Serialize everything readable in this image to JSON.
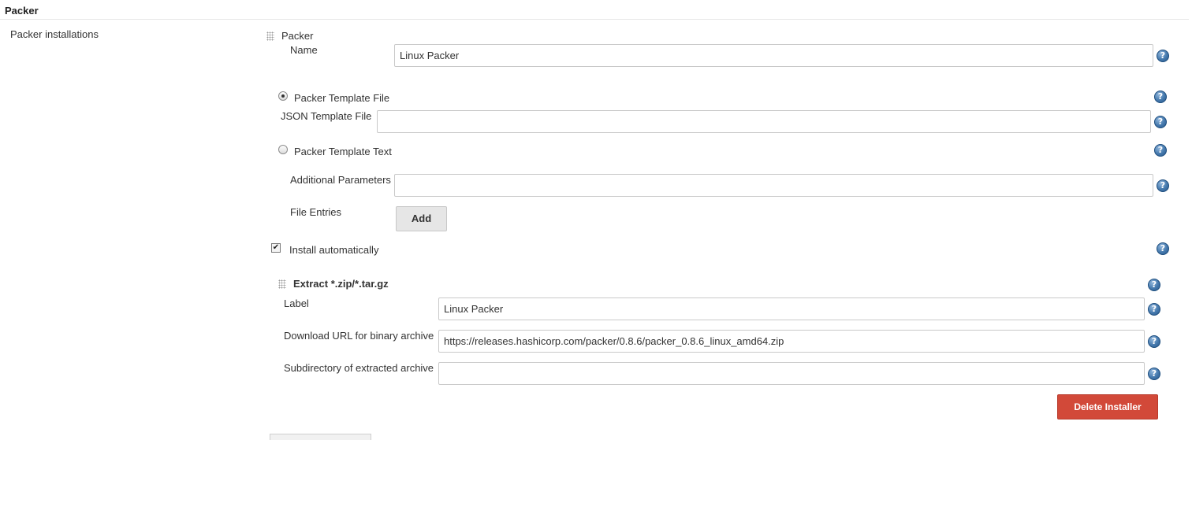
{
  "section": {
    "title": "Packer"
  },
  "installations_label": "Packer installations",
  "installation": {
    "header": "Packer",
    "name": {
      "label": "Name",
      "value": "Linux Packer",
      "help_icon": "question-circle-icon"
    },
    "template_file": {
      "label": "Packer Template File",
      "selected": true
    },
    "json_template_file": {
      "label": "JSON Template File",
      "value": ""
    },
    "template_text": {
      "label": "Packer Template Text",
      "selected": false
    },
    "additional_parameters": {
      "label": "Additional Parameters",
      "value": ""
    },
    "file_entries": {
      "label": "File Entries",
      "add_label": "Add"
    },
    "install_automatically": {
      "label": "Install automatically",
      "checked": true
    }
  },
  "installer": {
    "header": "Extract *.zip/*.tar.gz",
    "label_field": {
      "label": "Label",
      "value": "Linux Packer"
    },
    "download_url": {
      "label": "Download URL for binary archive",
      "value": "https://releases.hashicorp.com/packer/0.8.6/packer_0.8.6_linux_amd64.zip"
    },
    "subdirectory": {
      "label": "Subdirectory of extracted archive",
      "value": ""
    },
    "delete_label": "Delete Installer"
  },
  "colors": {
    "delete_button": "#d24939",
    "help_icon": "#4579ad",
    "add_button": "#e6e6e6"
  }
}
